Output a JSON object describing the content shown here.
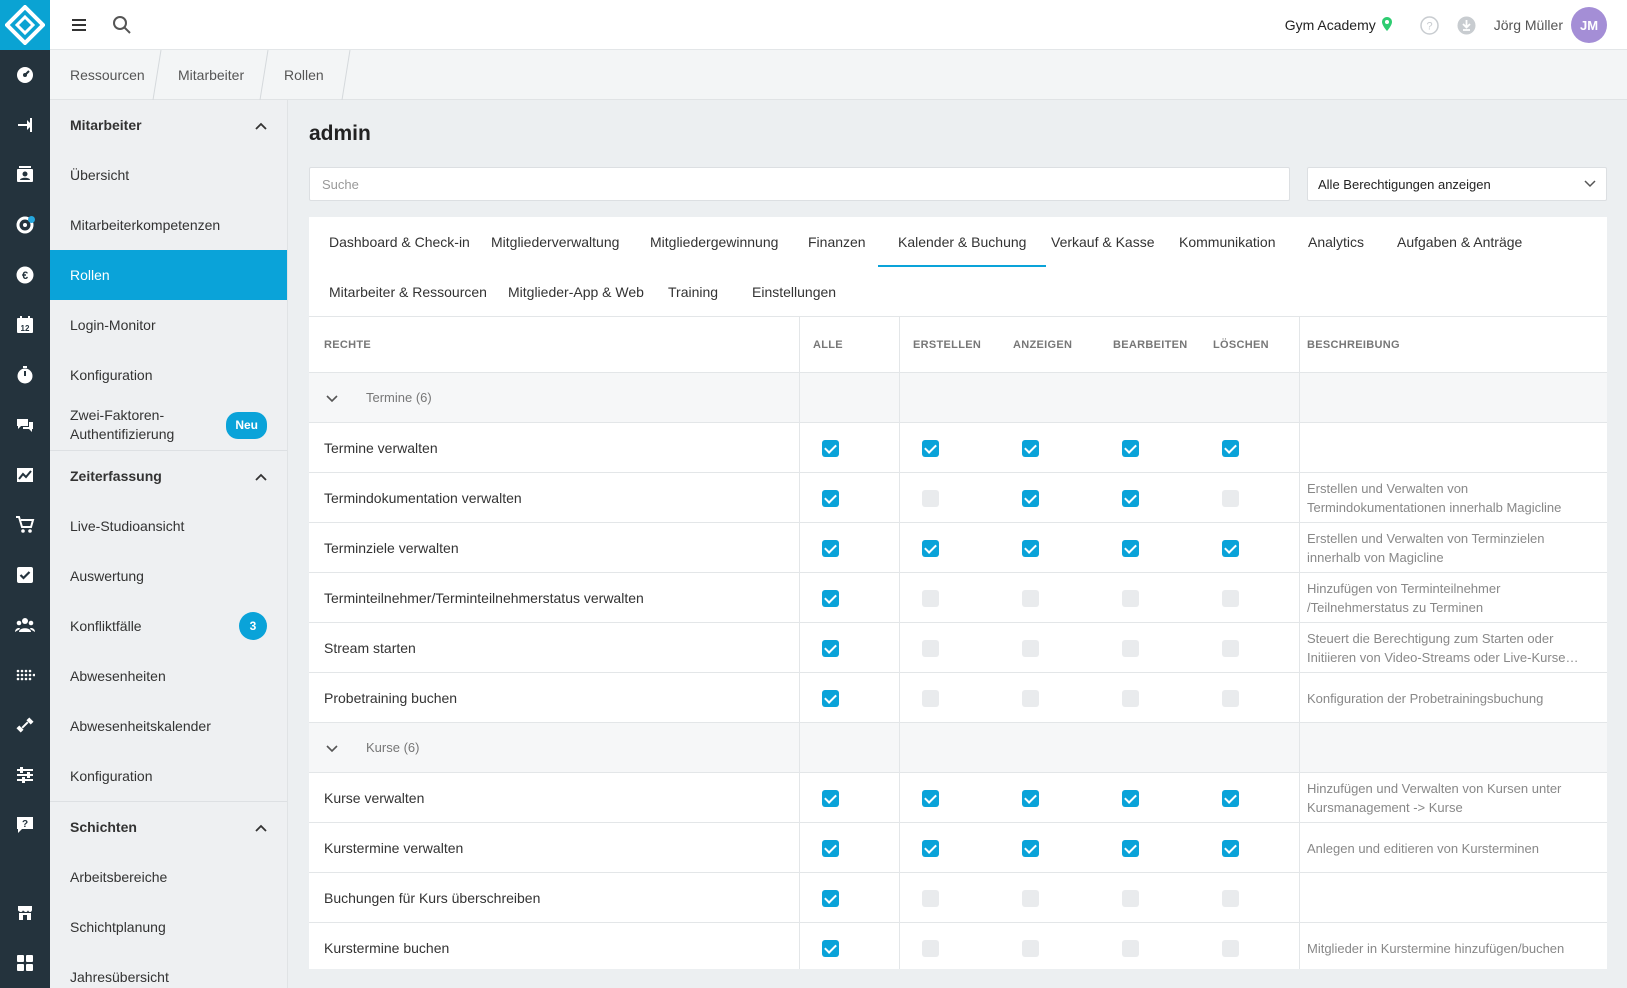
{
  "topbar": {
    "studio": "Gym Academy",
    "user_name": "Jörg Müller",
    "avatar_initials": "JM"
  },
  "rail": {
    "icons": [
      "dashboard-icon",
      "login-icon",
      "contacts-icon",
      "settings-cog-icon",
      "euro-icon",
      "calendar-icon",
      "stopwatch-icon",
      "chat-icon",
      "chart-icon",
      "cart-icon",
      "checkbox-icon",
      "people-icon",
      "dots-grid-icon",
      "dumbbell-icon",
      "sliders-icon",
      "help-chat-icon"
    ],
    "active_index": 11,
    "calendar_day": "12"
  },
  "breadcrumbs": [
    "Ressourcen",
    "Mitarbeiter",
    "Rollen"
  ],
  "sidebar": {
    "sections": [
      {
        "title": "Mitarbeiter",
        "items": [
          {
            "label": "Übersicht"
          },
          {
            "label": "Mitarbeiterkompetenzen"
          },
          {
            "label": "Rollen",
            "active": true
          },
          {
            "label": "Login-Monitor"
          },
          {
            "label": "Konfiguration"
          },
          {
            "label": "Zwei-Faktoren-Authentifizierung",
            "badge": "Neu"
          }
        ]
      },
      {
        "title": "Zeiterfassung",
        "items": [
          {
            "label": "Live-Studioansicht"
          },
          {
            "label": "Auswertung"
          },
          {
            "label": "Konfliktfälle",
            "count": "3"
          },
          {
            "label": "Abwesenheiten"
          },
          {
            "label": "Abwesenheitskalender"
          },
          {
            "label": "Konfiguration"
          }
        ]
      },
      {
        "title": "Schichten",
        "items": [
          {
            "label": "Arbeitsbereiche"
          },
          {
            "label": "Schichtplanung"
          },
          {
            "label": "Jahresübersicht"
          }
        ]
      }
    ]
  },
  "main": {
    "title": "admin",
    "search_placeholder": "Suche",
    "filter_value": "Alle Berechtigungen anzeigen",
    "tabs": [
      {
        "label": "Dashboard & Check-in"
      },
      {
        "label": "Mitgliederverwaltung"
      },
      {
        "label": "Mitgliedergewinnung"
      },
      {
        "label": "Finanzen"
      },
      {
        "label": "Kalender & Buchung",
        "active": true
      },
      {
        "label": "Verkauf & Kasse"
      },
      {
        "label": "Kommunikation"
      },
      {
        "label": "Analytics"
      },
      {
        "label": "Aufgaben & Anträge"
      },
      {
        "label": "Mitarbeiter & Ressourcen"
      },
      {
        "label": "Mitglieder-App & Web"
      },
      {
        "label": "Training"
      },
      {
        "label": "Einstellungen"
      }
    ],
    "columns": {
      "rights": "RECHTE",
      "all": "ALLE",
      "create": "ERSTELLEN",
      "view": "ANZEIGEN",
      "edit": "BEARBEITEN",
      "delete": "LÖSCHEN",
      "description": "BESCHREIBUNG"
    },
    "groups": [
      {
        "label": "Termine (6)",
        "rows": [
          {
            "name": "Termine verwalten",
            "checks": [
              true,
              true,
              true,
              true,
              true
            ],
            "desc": ""
          },
          {
            "name": "Termindokumentation verwalten",
            "checks": [
              true,
              false,
              true,
              true,
              false
            ],
            "desc": "Erstellen und Verwalten von Termindokumentationen innerhalb Magicline"
          },
          {
            "name": "Terminziele verwalten",
            "checks": [
              true,
              true,
              true,
              true,
              true
            ],
            "desc": "Erstellen und Verwalten von Terminzielen innerhalb von Magicline"
          },
          {
            "name": "Terminteilnehmer/Terminteilnehmerstatus verwalten",
            "checks": [
              true,
              false,
              false,
              false,
              false
            ],
            "desc": "Hinzufügen von Terminteilnehmer /Teilnehmerstatus zu Terminen"
          },
          {
            "name": "Stream starten",
            "checks": [
              true,
              false,
              false,
              false,
              false
            ],
            "desc": "Steuert die Berechtigung zum Starten oder Initiieren von Video-Streams oder Live-Kurse…"
          },
          {
            "name": "Probetraining buchen",
            "checks": [
              true,
              false,
              false,
              false,
              false
            ],
            "desc": "Konfiguration der Probetrainingsbuchung"
          }
        ]
      },
      {
        "label": "Kurse (6)",
        "rows": [
          {
            "name": "Kurse verwalten",
            "checks": [
              true,
              true,
              true,
              true,
              true
            ],
            "desc": "Hinzufügen und Verwalten von Kursen unter Kursmanagement -> Kurse"
          },
          {
            "name": "Kurstermine verwalten",
            "checks": [
              true,
              true,
              true,
              true,
              true
            ],
            "desc": "Anlegen und editieren von Kursterminen"
          },
          {
            "name": "Buchungen für Kurs überschreiben",
            "checks": [
              true,
              false,
              false,
              false,
              false
            ],
            "desc": ""
          },
          {
            "name": "Kurstermine buchen",
            "checks": [
              true,
              false,
              false,
              false,
              false
            ],
            "desc": "Mitglieder in Kurstermine hinzufügen/buchen"
          }
        ]
      }
    ]
  },
  "colors": {
    "accent": "#0aa3d9",
    "rail": "#24333d",
    "avatar": "#a48ed6",
    "pin": "#2ecc71"
  }
}
